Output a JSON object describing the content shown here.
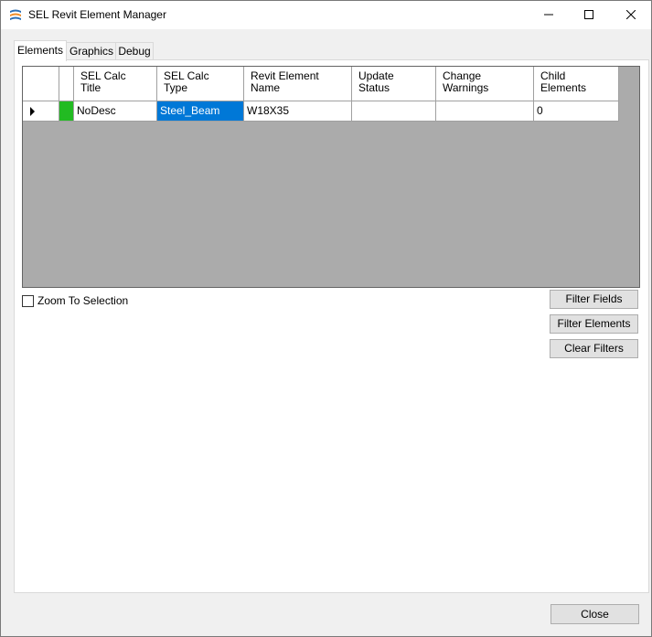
{
  "window": {
    "title": "SEL Revit Element Manager"
  },
  "tabs": [
    {
      "label": "Elements",
      "active": true
    },
    {
      "label": "Graphics",
      "active": false
    },
    {
      "label": "Debug",
      "active": false
    }
  ],
  "grid": {
    "columns": [
      "SEL Calc\nTitle",
      "SEL Calc\nType",
      "Revit Element\nName",
      "Update\nStatus",
      "Change\nWarnings",
      "Child\nElements"
    ],
    "rows": [
      {
        "status_color": "#22bb22",
        "cells": [
          "NoDesc",
          "Steel_Beam",
          "W18X35",
          "",
          "",
          "0"
        ]
      }
    ]
  },
  "zoom_to_selection": {
    "label": "Zoom To Selection",
    "checked": false
  },
  "buttons": {
    "filter_fields": "Filter Fields",
    "filter_elements": "Filter Elements",
    "clear_filters": "Clear Filters",
    "close": "Close"
  }
}
